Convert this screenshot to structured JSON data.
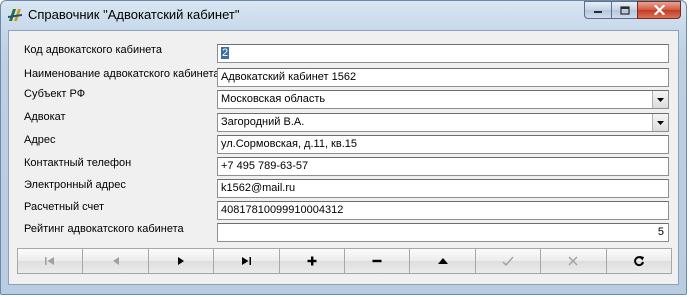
{
  "window": {
    "title": "Справочник \"Адвокатский кабинет\""
  },
  "form": {
    "fields": [
      {
        "label": "Код адвокатского кабинета",
        "value": "2",
        "kind": "text",
        "selected": true
      },
      {
        "label": "Наименование адвокатского кабинета",
        "value": "Адвокатский кабинет 1562",
        "kind": "text"
      },
      {
        "label": "Субъект РФ",
        "value": "Московская область",
        "kind": "select"
      },
      {
        "label": "Адвокат",
        "value": "Загородний В.А.",
        "kind": "select"
      },
      {
        "label": "Адрес",
        "value": "ул.Сормовская, д.11, кв.15",
        "kind": "text"
      },
      {
        "label": "Контактный телефон",
        "value": "+7 495 789-63-57",
        "kind": "text"
      },
      {
        "label": "Электронный адрес",
        "value": "k1562@mail.ru",
        "kind": "text"
      },
      {
        "label": "Расчетный счет",
        "value": "40817810099910004312",
        "kind": "text"
      },
      {
        "label": "Рейтинг адвокатского кабинета",
        "value": "5",
        "kind": "number"
      }
    ]
  },
  "navigator": {
    "buttons": [
      {
        "name": "first-record-button",
        "icon": "first-record-icon",
        "enabled": false
      },
      {
        "name": "prior-record-button",
        "icon": "prior-record-icon",
        "enabled": false
      },
      {
        "name": "next-record-button",
        "icon": "next-record-icon",
        "enabled": true
      },
      {
        "name": "last-record-button",
        "icon": "last-record-icon",
        "enabled": true
      },
      {
        "name": "insert-record-button",
        "icon": "plus-icon",
        "enabled": true
      },
      {
        "name": "delete-record-button",
        "icon": "minus-icon",
        "enabled": true
      },
      {
        "name": "edit-record-button",
        "icon": "edit-triangle-icon",
        "enabled": true
      },
      {
        "name": "post-record-button",
        "icon": "checkmark-icon",
        "enabled": false
      },
      {
        "name": "cancel-edit-button",
        "icon": "cancel-x-icon",
        "enabled": false
      },
      {
        "name": "refresh-button",
        "icon": "refresh-icon",
        "enabled": true
      }
    ]
  },
  "colors": {
    "selection": "#3a6ea5",
    "close_button": "#c13c24",
    "disabled_icon": "#a0a0a0",
    "enabled_icon": "#000000"
  }
}
